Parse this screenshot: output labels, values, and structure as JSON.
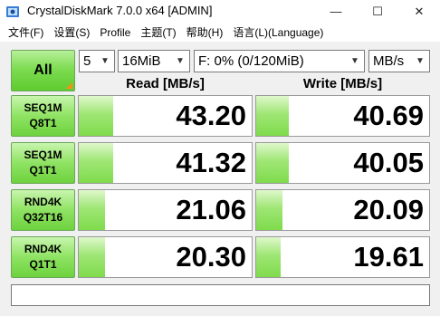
{
  "window": {
    "title": "CrystalDiskMark 7.0.0 x64 [ADMIN]",
    "buttons": {
      "minimize": "—",
      "maximize": "☐",
      "close": "✕"
    }
  },
  "menu": [
    {
      "label": "文件(F)"
    },
    {
      "label": "设置(S)"
    },
    {
      "label": "Profile"
    },
    {
      "label": "主题(T)"
    },
    {
      "label": "帮助(H)"
    },
    {
      "label": "语言(L)(Language)"
    }
  ],
  "controls": {
    "all_label": "All",
    "test_count": "5",
    "test_size": "16MiB",
    "drive": "F: 0% (0/120MiB)",
    "unit": "MB/s"
  },
  "headers": {
    "read": "Read [MB/s]",
    "write": "Write [MB/s]"
  },
  "tests": [
    {
      "line1": "SEQ1M",
      "line2": "Q8T1",
      "read": "43.20",
      "write": "40.69",
      "read_fill": 0.2,
      "write_fill": 0.19
    },
    {
      "line1": "SEQ1M",
      "line2": "Q1T1",
      "read": "41.32",
      "write": "40.05",
      "read_fill": 0.2,
      "write_fill": 0.19
    },
    {
      "line1": "RND4K",
      "line2": "Q32T16",
      "read": "21.06",
      "write": "20.09",
      "read_fill": 0.15,
      "write_fill": 0.15
    },
    {
      "line1": "RND4K",
      "line2": "Q1T1",
      "read": "20.30",
      "write": "19.61",
      "read_fill": 0.15,
      "write_fill": 0.14
    }
  ],
  "comment": "",
  "colors": {
    "accent_green": "#7edc52",
    "corner_orange": "#ff8c1a"
  },
  "icons": {
    "app": "crystaldiskmark-icon",
    "dropdown": "chevron-down-icon"
  }
}
